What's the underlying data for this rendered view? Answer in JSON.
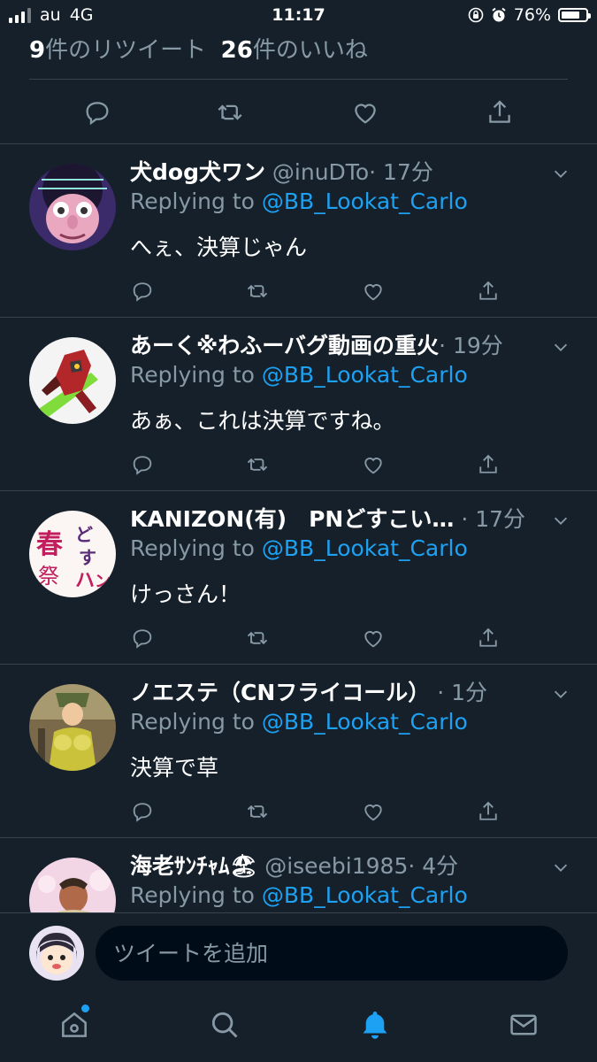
{
  "status_bar": {
    "carrier": "au",
    "network": "4G",
    "time": "11:17",
    "battery": "76%"
  },
  "counts": {
    "retweets_num": "9",
    "retweets_label": "件のリツイート",
    "likes_num": "26",
    "likes_label": "件のいいね"
  },
  "replies": [
    {
      "name": "犬dog犬ワン",
      "handle": "@inuDTo",
      "time": "· 17分",
      "replying_label": "Replying to",
      "mention": "@BB_Lookat_Carlo",
      "text": "へぇ、決算じゃん"
    },
    {
      "name": "あーく※わふーバグ動画の重火",
      "handle": "",
      "time": "· 19分",
      "replying_label": "Replying to",
      "mention": "@BB_Lookat_Carlo",
      "text": "あぁ、これは決算ですね。"
    },
    {
      "name": "KANIZON(有)　PNどすこい…",
      "handle": "",
      "time": "· 17分",
      "replying_label": "Replying to",
      "mention": "@BB_Lookat_Carlo",
      "text": "けっさん！"
    },
    {
      "name": "ノエステ（CNフライコール）",
      "handle": "",
      "time": "· 1分",
      "replying_label": "Replying to",
      "mention": "@BB_Lookat_Carlo",
      "text": "決算で草"
    },
    {
      "name": "海老ｻﾝﾁｬﾑ🏖",
      "handle": "@iseebi1985",
      "time": "· 4分",
      "replying_label": "Replying to",
      "mention": "@BB_Lookat_Carlo",
      "text": ""
    }
  ],
  "avatar_art": {
    "avatar_3_glyphs": "春の祭り ハンどすこい"
  },
  "composer": {
    "placeholder": "ツイートを追加"
  },
  "tabs": [
    {
      "icon": "home-icon",
      "active": false,
      "badge": true
    },
    {
      "icon": "search-icon",
      "active": false
    },
    {
      "icon": "bell-icon",
      "active": true
    },
    {
      "icon": "mail-icon",
      "active": false
    }
  ],
  "colors": {
    "background": "#15202b",
    "divider": "#38444d",
    "muted": "#8899a6",
    "accent": "#1da1f2"
  }
}
